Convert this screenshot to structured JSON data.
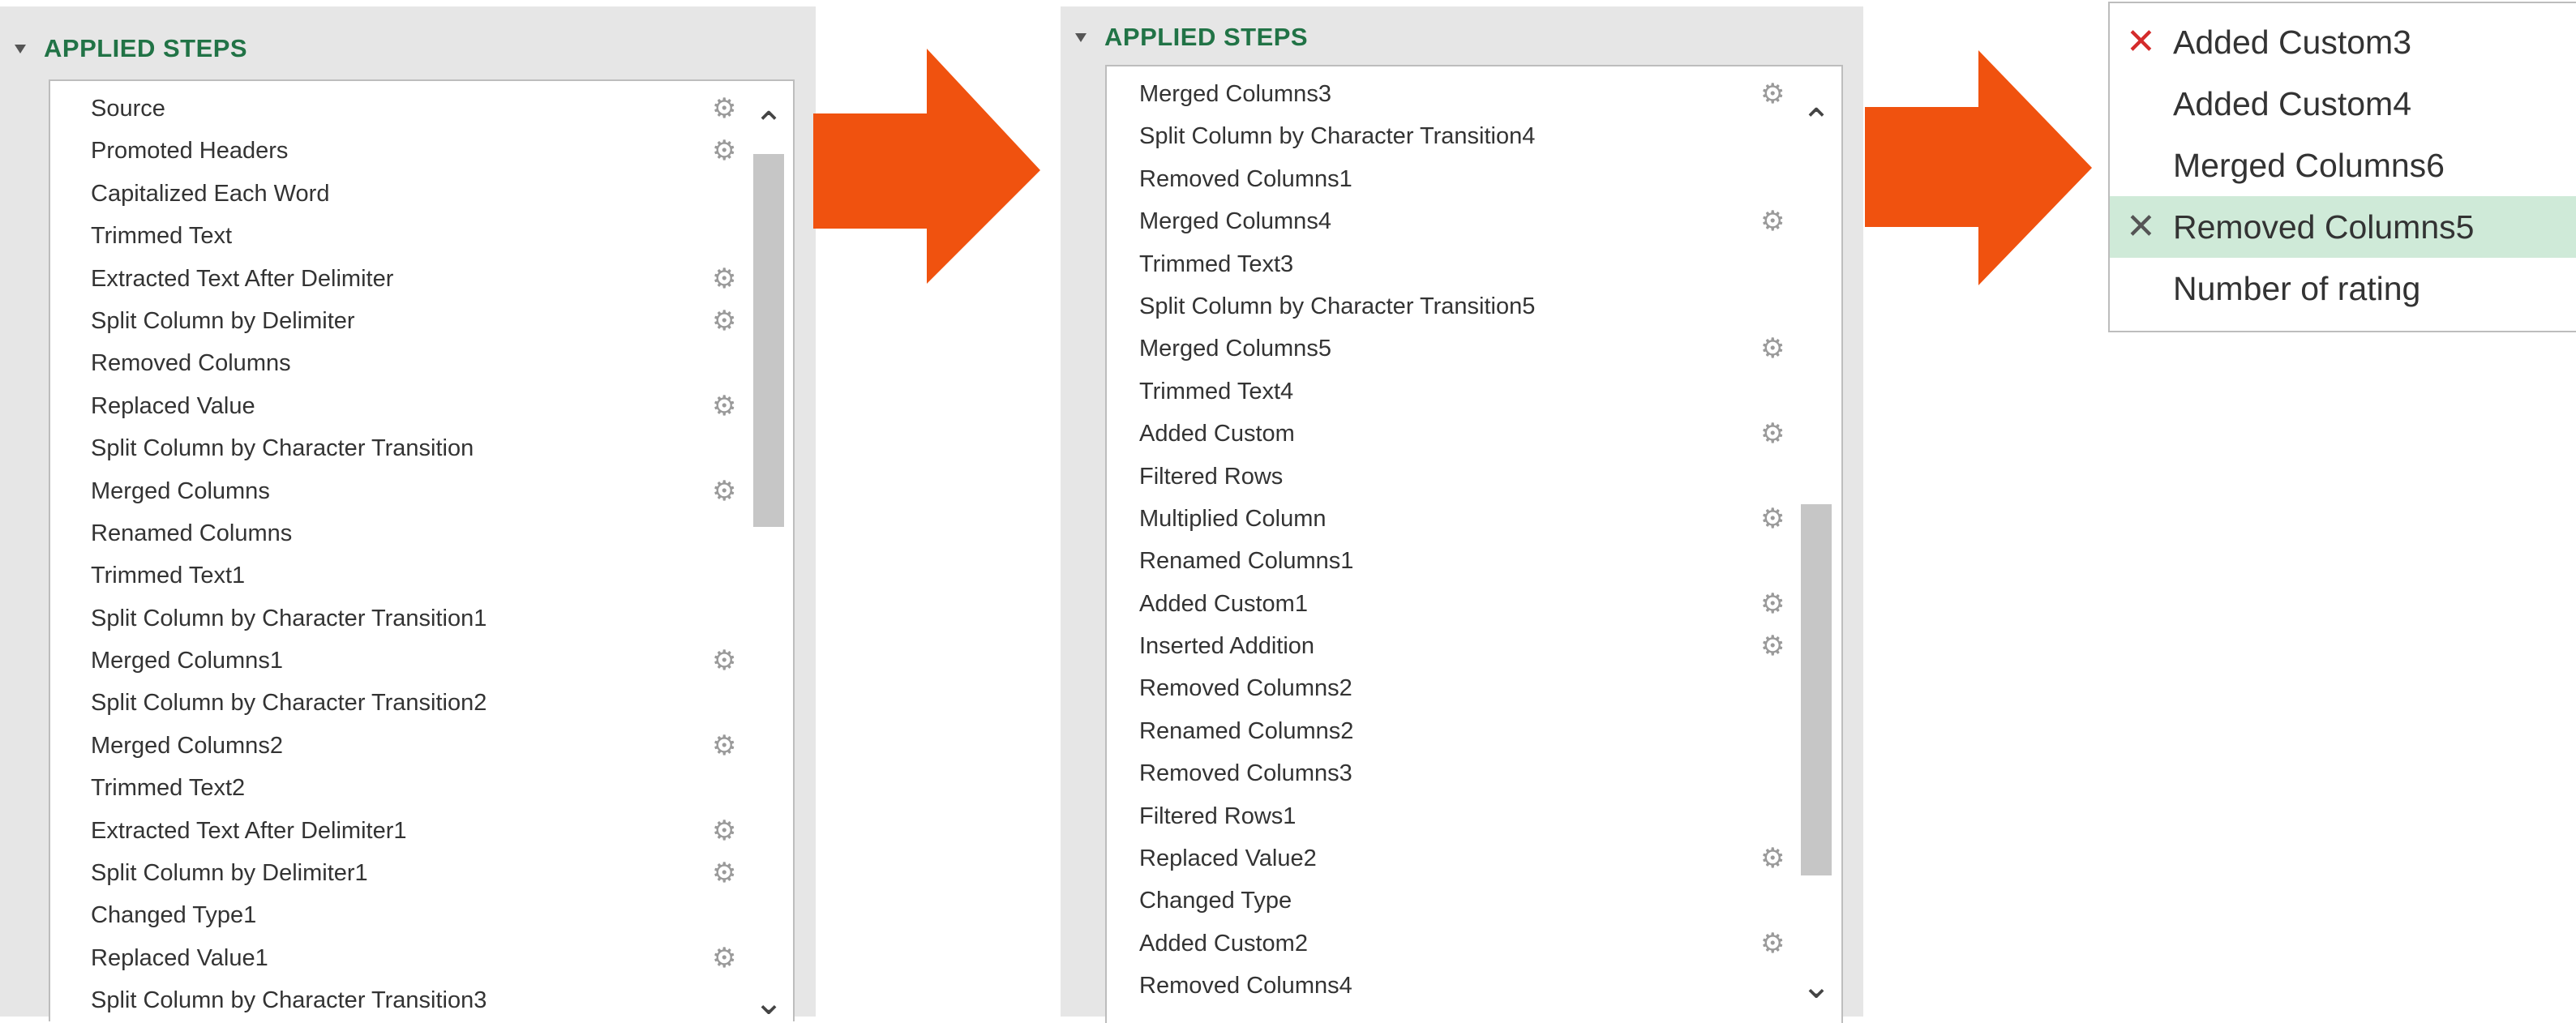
{
  "panels": [
    {
      "header": "APPLIED STEPS",
      "steps": [
        {
          "label": "Source",
          "gear": true
        },
        {
          "label": "Promoted Headers",
          "gear": true
        },
        {
          "label": "Capitalized Each Word",
          "gear": false
        },
        {
          "label": "Trimmed Text",
          "gear": false
        },
        {
          "label": "Extracted Text After Delimiter",
          "gear": true
        },
        {
          "label": "Split Column by Delimiter",
          "gear": true
        },
        {
          "label": "Removed Columns",
          "gear": false
        },
        {
          "label": "Replaced Value",
          "gear": true
        },
        {
          "label": "Split Column by Character Transition",
          "gear": false
        },
        {
          "label": "Merged Columns",
          "gear": true
        },
        {
          "label": "Renamed Columns",
          "gear": false
        },
        {
          "label": "Trimmed Text1",
          "gear": false
        },
        {
          "label": "Split Column by Character Transition1",
          "gear": false
        },
        {
          "label": "Merged Columns1",
          "gear": true
        },
        {
          "label": "Split Column by Character Transition2",
          "gear": false
        },
        {
          "label": "Merged Columns2",
          "gear": true
        },
        {
          "label": "Trimmed Text2",
          "gear": false
        },
        {
          "label": "Extracted Text After Delimiter1",
          "gear": true
        },
        {
          "label": "Split Column by Delimiter1",
          "gear": true
        },
        {
          "label": "Changed Type1",
          "gear": false
        },
        {
          "label": "Replaced Value1",
          "gear": true
        },
        {
          "label": "Split Column by Character Transition3",
          "gear": false
        }
      ]
    },
    {
      "header": "APPLIED STEPS",
      "partial_step": "Split Column by Character Transition3",
      "steps": [
        {
          "label": "Merged Columns3",
          "gear": true
        },
        {
          "label": "Split Column by Character Transition4",
          "gear": false
        },
        {
          "label": "Removed Columns1",
          "gear": false
        },
        {
          "label": "Merged Columns4",
          "gear": true
        },
        {
          "label": "Trimmed Text3",
          "gear": false
        },
        {
          "label": "Split Column by Character Transition5",
          "gear": false
        },
        {
          "label": "Merged Columns5",
          "gear": true
        },
        {
          "label": "Trimmed Text4",
          "gear": false
        },
        {
          "label": "Added Custom",
          "gear": true
        },
        {
          "label": "Filtered Rows",
          "gear": false
        },
        {
          "label": "Multiplied Column",
          "gear": true
        },
        {
          "label": "Renamed Columns1",
          "gear": false
        },
        {
          "label": "Added Custom1",
          "gear": true
        },
        {
          "label": "Inserted Addition",
          "gear": true
        },
        {
          "label": "Removed Columns2",
          "gear": false
        },
        {
          "label": "Renamed Columns2",
          "gear": false
        },
        {
          "label": "Removed Columns3",
          "gear": false
        },
        {
          "label": "Filtered Rows1",
          "gear": false
        },
        {
          "label": "Replaced Value2",
          "gear": true
        },
        {
          "label": "Changed Type",
          "gear": false
        },
        {
          "label": "Added Custom2",
          "gear": true
        },
        {
          "label": "Removed Columns4",
          "gear": false
        }
      ]
    }
  ],
  "menu": {
    "items": [
      {
        "label": "Added Custom3",
        "icon": "delete-x-icon",
        "icon_color": "#d42b2b",
        "selected": false
      },
      {
        "label": "Added Custom4",
        "icon": "",
        "icon_color": "",
        "selected": false
      },
      {
        "label": "Merged Columns6",
        "icon": "",
        "icon_color": "",
        "selected": false
      },
      {
        "label": "Removed Columns5",
        "icon": "delete-x-icon",
        "icon_color": "#555555",
        "selected": true
      },
      {
        "label": "Number of rating",
        "icon": "",
        "icon_color": "",
        "selected": false
      }
    ]
  },
  "colors": {
    "header_green": "#217346",
    "arrow_orange": "#f0520f",
    "selected_bg": "#cfead8",
    "panel_bg": "#e6e6e6"
  },
  "icons": {
    "gear": "gear-icon",
    "scroll_up": "chevron-up-icon",
    "scroll_down": "chevron-down-icon",
    "collapse": "collapse-triangle-icon",
    "arrow": "arrow-right-icon"
  }
}
